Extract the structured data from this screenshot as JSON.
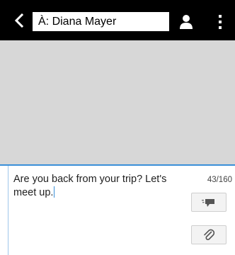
{
  "header": {
    "recipient_value": "À: Diana Mayer",
    "icons": {
      "back": "back-arrow-icon",
      "contact": "person-icon",
      "menu": "overflow-menu-icon"
    }
  },
  "compose": {
    "message_text": "Are you back from your trip? Let's meet up.",
    "char_counter": "43/160",
    "icons": {
      "send": "send-icon",
      "attach": "paperclip-icon"
    }
  },
  "colors": {
    "topbar": "#000000",
    "thread_background": "#d7d7d7",
    "accent": "#3a8fd8"
  }
}
